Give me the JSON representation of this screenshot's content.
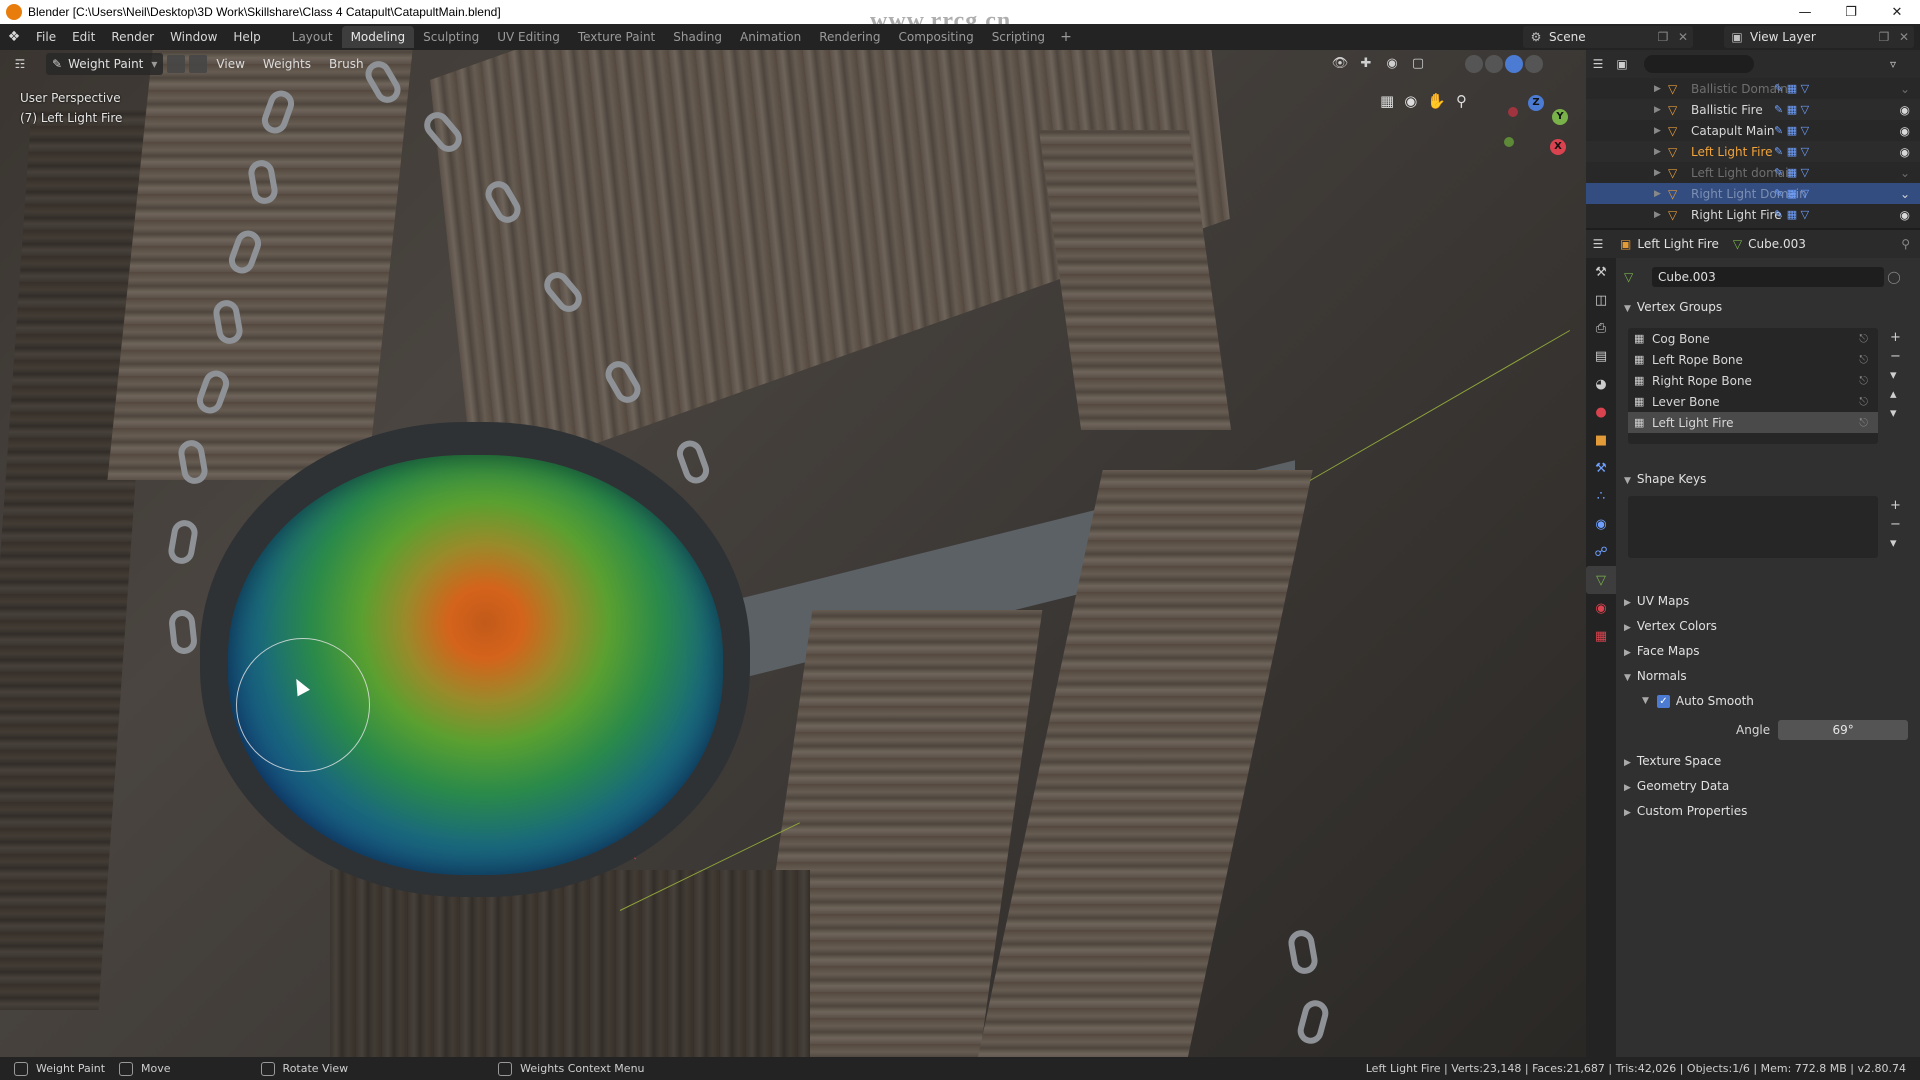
{
  "window": {
    "title": "Blender [C:\\Users\\Neil\\Desktop\\3D Work\\Skillshare\\Class 4 Catapult\\CatapultMain.blend]",
    "controls": [
      "—",
      "❐",
      "✕"
    ]
  },
  "watermark_top": "www.rrcg.cn",
  "menu": [
    "File",
    "Edit",
    "Render",
    "Window",
    "Help"
  ],
  "workspaces": [
    "Layout",
    "Modeling",
    "Sculpting",
    "UV Editing",
    "Texture Paint",
    "Shading",
    "Animation",
    "Rendering",
    "Compositing",
    "Scripting"
  ],
  "active_workspace": "Modeling",
  "scene": "Scene",
  "view_layer": "View Layer",
  "viewport": {
    "mode": "Weight Paint",
    "menus": [
      "View",
      "Weights",
      "Brush"
    ],
    "info_line1": "User Perspective",
    "info_line2": "(7) Left Light Fire"
  },
  "outliner": {
    "search_placeholder": "",
    "rows": [
      {
        "name": "Ballistic Domain",
        "state": "dim"
      },
      {
        "name": "Ballistic Fire",
        "state": "normal"
      },
      {
        "name": "Catapult Main",
        "state": "normal"
      },
      {
        "name": "Left Light Fire",
        "state": "active"
      },
      {
        "name": "Left Light domain",
        "state": "dim"
      },
      {
        "name": "Right Light Domain",
        "state": "selected"
      },
      {
        "name": "Right Light Fire",
        "state": "normal"
      }
    ]
  },
  "properties": {
    "breadcrumb_object": "Left Light Fire",
    "breadcrumb_mesh": "Cube.003",
    "mesh_name": "Cube.003",
    "vertex_groups_title": "Vertex Groups",
    "vertex_groups": [
      "Cog Bone",
      "Left Rope Bone",
      "Right Rope Bone",
      "Lever Bone",
      "Left Light Fire"
    ],
    "active_vertex_group": "Left Light Fire",
    "shape_keys_title": "Shape Keys",
    "panels": [
      "UV Maps",
      "Vertex Colors",
      "Face Maps",
      "Normals",
      "Texture Space",
      "Geometry Data",
      "Custom Properties"
    ],
    "auto_smooth_label": "Auto Smooth",
    "auto_smooth": true,
    "angle_label": "Angle",
    "angle_value": "69°"
  },
  "statusbar": {
    "items": [
      "Weight Paint",
      "Move",
      "Rotate View",
      "Weights Context Menu"
    ],
    "stats": "Left Light Fire | Verts:23,148 | Faces:21,687 | Tris:42,026 | Objects:1/6 | Mem: 772.8 MB | v2.80.74"
  },
  "colors": {
    "accent_blue": "#4c7bd3",
    "active_orange": "#f1a33c",
    "object_orange": "#e39b3a",
    "mesh_green": "#7ab24a",
    "selected_row": "#334d80"
  }
}
